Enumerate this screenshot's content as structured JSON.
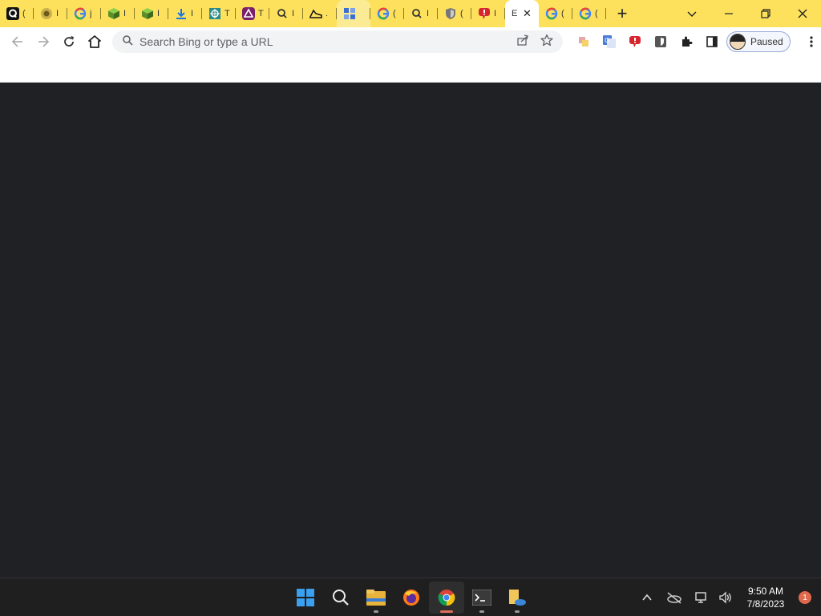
{
  "browser": {
    "tabs": [
      {
        "icon": "q-icon",
        "title": "("
      },
      {
        "icon": "sunflower-icon",
        "title": "I"
      },
      {
        "icon": "google-icon",
        "title": "j"
      },
      {
        "icon": "cube-icon",
        "title": "I"
      },
      {
        "icon": "cube-icon",
        "title": "I"
      },
      {
        "icon": "download-icon",
        "title": "I"
      },
      {
        "icon": "crosshair-icon",
        "title": "T"
      },
      {
        "icon": "triangle-logo-icon",
        "title": "T"
      },
      {
        "icon": "search-icon",
        "title": "I"
      },
      {
        "icon": "shoe-icon",
        "title": "."
      },
      {
        "icon": "grid-icon",
        "title": ""
      },
      {
        "icon": "google-icon",
        "title": "("
      },
      {
        "icon": "search-icon",
        "title": "I"
      },
      {
        "icon": "shield-icon",
        "title": "("
      },
      {
        "icon": "thumbs-down-icon",
        "title": "I"
      },
      {
        "icon": "blank-icon",
        "title": "E",
        "active": true
      },
      {
        "icon": "google-icon",
        "title": "("
      },
      {
        "icon": "google-icon",
        "title": "("
      }
    ],
    "address": {
      "placeholder": "Search Bing or type a URL"
    },
    "profile": {
      "label": "Paused"
    }
  },
  "taskbar": {
    "apps": [
      "windows-start-icon",
      "search-icon",
      "file-explorer-icon",
      "firefox-icon",
      "chrome-icon",
      "terminal-icon",
      "onedrive-folder-icon"
    ],
    "clock": {
      "time": "9:50 AM",
      "date": "7/8/2023"
    },
    "notification_count": "1"
  },
  "colors": {
    "tabstrip": "#fde15c",
    "content": "#202124",
    "taskbar": "#1f1f1f"
  }
}
